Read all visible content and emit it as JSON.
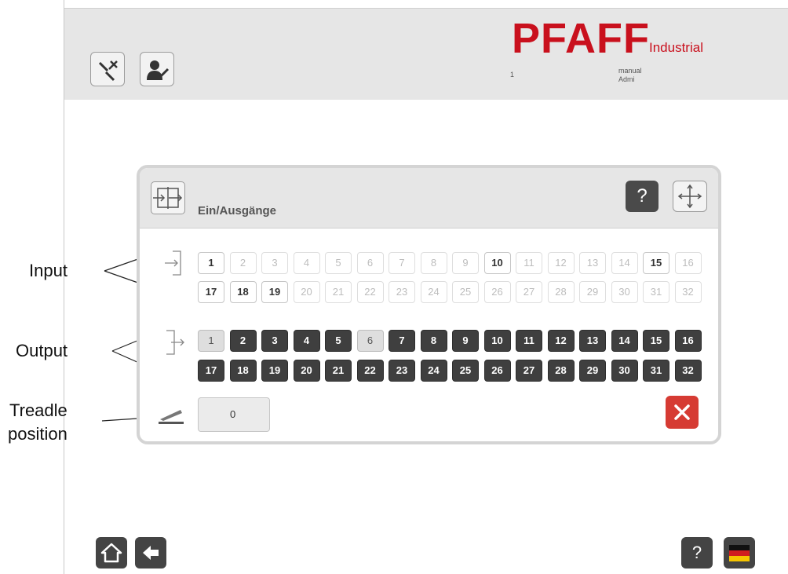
{
  "header": {
    "brand": "PFAFF",
    "brand_sub": "Industrial",
    "num": "1",
    "mode": "manual",
    "user": "Admi"
  },
  "annotations": {
    "input": "Input",
    "output": "Output",
    "treadle_line1": "Treadle",
    "treadle_line2": "position"
  },
  "dialog": {
    "title": "Ein/Ausgänge",
    "help_label": "?",
    "inputs": {
      "row1": [
        {
          "n": "1",
          "on": true
        },
        {
          "n": "2",
          "on": false
        },
        {
          "n": "3",
          "on": false
        },
        {
          "n": "4",
          "on": false
        },
        {
          "n": "5",
          "on": false
        },
        {
          "n": "6",
          "on": false
        },
        {
          "n": "7",
          "on": false
        },
        {
          "n": "8",
          "on": false
        },
        {
          "n": "9",
          "on": false
        },
        {
          "n": "10",
          "on": true
        },
        {
          "n": "11",
          "on": false
        },
        {
          "n": "12",
          "on": false
        },
        {
          "n": "13",
          "on": false
        },
        {
          "n": "14",
          "on": false
        },
        {
          "n": "15",
          "on": true
        },
        {
          "n": "16",
          "on": false
        }
      ],
      "row2": [
        {
          "n": "17",
          "on": true
        },
        {
          "n": "18",
          "on": true
        },
        {
          "n": "19",
          "on": true
        },
        {
          "n": "20",
          "on": false
        },
        {
          "n": "21",
          "on": false
        },
        {
          "n": "22",
          "on": false
        },
        {
          "n": "23",
          "on": false
        },
        {
          "n": "24",
          "on": false
        },
        {
          "n": "25",
          "on": false
        },
        {
          "n": "26",
          "on": false
        },
        {
          "n": "27",
          "on": false
        },
        {
          "n": "28",
          "on": false
        },
        {
          "n": "29",
          "on": false
        },
        {
          "n": "30",
          "on": false
        },
        {
          "n": "31",
          "on": false
        },
        {
          "n": "32",
          "on": false
        }
      ]
    },
    "outputs": {
      "row1": [
        {
          "n": "1",
          "on": false
        },
        {
          "n": "2",
          "on": true
        },
        {
          "n": "3",
          "on": true
        },
        {
          "n": "4",
          "on": true
        },
        {
          "n": "5",
          "on": true
        },
        {
          "n": "6",
          "on": false
        },
        {
          "n": "7",
          "on": true
        },
        {
          "n": "8",
          "on": true
        },
        {
          "n": "9",
          "on": true
        },
        {
          "n": "10",
          "on": true
        },
        {
          "n": "11",
          "on": true
        },
        {
          "n": "12",
          "on": true
        },
        {
          "n": "13",
          "on": true
        },
        {
          "n": "14",
          "on": true
        },
        {
          "n": "15",
          "on": true
        },
        {
          "n": "16",
          "on": true
        }
      ],
      "row2": [
        {
          "n": "17",
          "on": true
        },
        {
          "n": "18",
          "on": true
        },
        {
          "n": "19",
          "on": true
        },
        {
          "n": "20",
          "on": true
        },
        {
          "n": "21",
          "on": true
        },
        {
          "n": "22",
          "on": true
        },
        {
          "n": "23",
          "on": true
        },
        {
          "n": "24",
          "on": true
        },
        {
          "n": "25",
          "on": true
        },
        {
          "n": "26",
          "on": true
        },
        {
          "n": "27",
          "on": true
        },
        {
          "n": "28",
          "on": true
        },
        {
          "n": "29",
          "on": true
        },
        {
          "n": "30",
          "on": true
        },
        {
          "n": "31",
          "on": true
        },
        {
          "n": "32",
          "on": true
        }
      ]
    },
    "treadle_value": "0"
  },
  "footer": {
    "help_label": "?"
  },
  "colors": {
    "brand_red": "#c9101d",
    "close_red": "#d63b33",
    "active_dark": "#3f3f3f",
    "panel_gray": "#e6e6e6"
  },
  "icons": {
    "tools": "tools-icon",
    "user_settings": "user-settings-icon",
    "io": "io-icon",
    "move": "move-icon",
    "input": "input-arrow-icon",
    "output": "output-arrow-icon",
    "treadle": "treadle-icon",
    "close": "close-icon",
    "home": "home-icon",
    "back": "back-arrow-icon",
    "language": "german-flag-icon"
  }
}
